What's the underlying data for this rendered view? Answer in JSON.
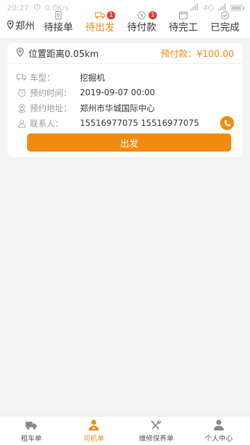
{
  "status": {
    "time": "20:27",
    "alarm_icon": "alarm-clock-icon",
    "speed": "0.0K/s",
    "network": "4G"
  },
  "header": {
    "city": "郑州",
    "tabs": [
      {
        "label": "待接单",
        "icon": "doc-icon",
        "badge": ""
      },
      {
        "label": "待出发",
        "icon": "truck-icon",
        "badge": "1",
        "active": true
      },
      {
        "label": "待付款",
        "icon": "yen-icon",
        "badge": "1"
      },
      {
        "label": "待完工",
        "icon": "calendar-icon",
        "badge": ""
      },
      {
        "label": "已完成",
        "icon": "check-circle-icon",
        "badge": ""
      }
    ]
  },
  "order": {
    "distance": "位置距离0.05km",
    "prepay_label": "预付款：¥100.00",
    "rows": [
      {
        "label": "车型：",
        "value": "挖掘机"
      },
      {
        "label": "预约时间：",
        "value": "2019-09-07 00:00"
      },
      {
        "label": "预约地址：",
        "value": "郑州市华城国际中心"
      },
      {
        "label": "联系人：",
        "value": "15516977075 15516977075"
      }
    ],
    "action_label": "出发"
  },
  "bottom_nav": [
    {
      "label": "租车单",
      "icon": "truck-icon"
    },
    {
      "label": "司机单",
      "icon": "driver-icon",
      "active": true
    },
    {
      "label": "维修保养单",
      "icon": "tools-icon"
    },
    {
      "label": "个人中心",
      "icon": "user-icon"
    }
  ],
  "colors": {
    "accent": "#f08a11",
    "badge": "#e83a3a",
    "bg": "#f4f4f4"
  }
}
